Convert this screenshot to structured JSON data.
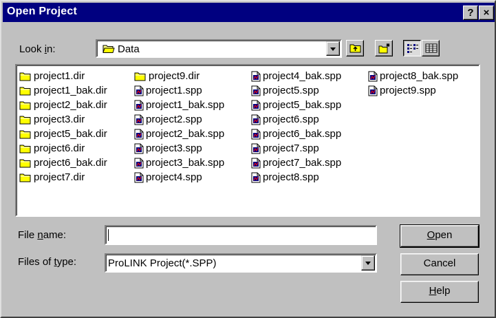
{
  "window": {
    "title": "Open Project",
    "help_glyph": "?",
    "close_glyph": "×"
  },
  "look_in": {
    "label_prefix": "Look ",
    "label_accel": "i",
    "label_suffix": "n:",
    "value": "Data"
  },
  "toolbar": {
    "icons": [
      "up-one-level-icon",
      "new-folder-icon",
      "list-view-icon",
      "details-view-icon"
    ],
    "active_view": "list"
  },
  "files": {
    "columns": [
      [
        {
          "name": "project1.dir",
          "kind": "folder"
        },
        {
          "name": "project1_bak.dir",
          "kind": "folder"
        },
        {
          "name": "project2_bak.dir",
          "kind": "folder"
        },
        {
          "name": "project3.dir",
          "kind": "folder"
        },
        {
          "name": "project5_bak.dir",
          "kind": "folder"
        },
        {
          "name": "project6.dir",
          "kind": "folder"
        },
        {
          "name": "project6_bak.dir",
          "kind": "folder"
        },
        {
          "name": "project7.dir",
          "kind": "folder"
        }
      ],
      [
        {
          "name": "project9.dir",
          "kind": "folder"
        },
        {
          "name": "project1.spp",
          "kind": "spp"
        },
        {
          "name": "project1_bak.spp",
          "kind": "spp"
        },
        {
          "name": "project2.spp",
          "kind": "spp"
        },
        {
          "name": "project2_bak.spp",
          "kind": "spp"
        },
        {
          "name": "project3.spp",
          "kind": "spp"
        },
        {
          "name": "project3_bak.spp",
          "kind": "spp"
        },
        {
          "name": "project4.spp",
          "kind": "spp"
        }
      ],
      [
        {
          "name": "project4_bak.spp",
          "kind": "spp"
        },
        {
          "name": "project5.spp",
          "kind": "spp"
        },
        {
          "name": "project5_bak.spp",
          "kind": "spp"
        },
        {
          "name": "project6.spp",
          "kind": "spp"
        },
        {
          "name": "project6_bak.spp",
          "kind": "spp"
        },
        {
          "name": "project7.spp",
          "kind": "spp"
        },
        {
          "name": "project7_bak.spp",
          "kind": "spp"
        },
        {
          "name": "project8.spp",
          "kind": "spp"
        }
      ],
      [
        {
          "name": "project8_bak.spp",
          "kind": "spp"
        },
        {
          "name": "project9.spp",
          "kind": "spp"
        }
      ]
    ]
  },
  "file_name": {
    "label_prefix": "File ",
    "label_accel": "n",
    "label_suffix": "ame:",
    "value": "",
    "placeholder": ""
  },
  "file_type": {
    "label_prefix": "Files of ",
    "label_accel": "t",
    "label_suffix": "ype:",
    "value": "ProLINK Project(*.SPP)"
  },
  "buttons": {
    "open_accel": "O",
    "open_rest": "pen",
    "cancel": "Cancel",
    "help_accel": "H",
    "help_rest": "elp"
  },
  "colors": {
    "titlebar": "#000080",
    "face": "#c0c0c0",
    "folder": "#ffff00"
  }
}
